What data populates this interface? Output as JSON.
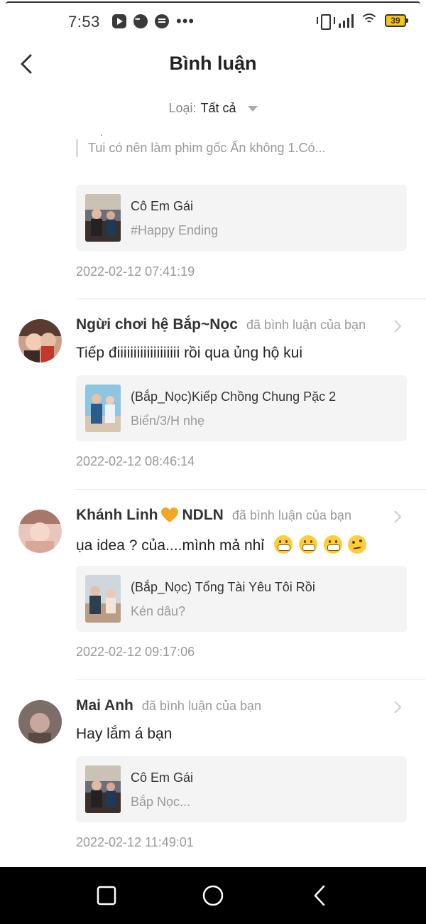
{
  "status_bar": {
    "time": "7:53",
    "battery": "39",
    "app_icons": [
      "youtube-icon",
      "messenger-icon",
      "chat-icon"
    ]
  },
  "header": {
    "title": "Bình luận"
  },
  "filter": {
    "label": "Loại:",
    "value": "Tất cả"
  },
  "partial_item": {
    "quote": "Tui có nên làm phim gốc Ấn không 1.Có...",
    "video_title": "Cô Em Gái",
    "video_subtitle": "#Happy Ending",
    "timestamp": "2022-02-12 07:41:19"
  },
  "comments": [
    {
      "author": "Ngừi chơi hệ Bắp~Nọc",
      "action": "đã bình luận của bạn",
      "text": "Tiếp điiiiiiiiiiiiiiiiiii rồi qua ủng hộ kui",
      "video_title": "(Bắp_Nọc)Kiếp Chồng Chung Pặc 2",
      "video_subtitle": "Biển/3/H nhẹ",
      "timestamp": "2022-02-12 08:46:14"
    },
    {
      "author_a": "Khánh Linh",
      "author_b": "NDLN",
      "action": "đã bình luận của bạn",
      "text": "ụa idea ? của....mình mả nhỉ",
      "emojis": [
        "grimacing-emoji",
        "grimacing-emoji",
        "grimacing-emoji",
        "raised-eyebrow-emoji"
      ],
      "video_title": "(Bắp_Nọc) Tổng Tài Yêu Tôi Rồi",
      "video_subtitle": "Kén dâu?",
      "timestamp": "2022-02-12 09:17:06"
    },
    {
      "author": "Mai Anh",
      "action": "đã bình luận của bạn",
      "text": "Hay lắm á bạn",
      "video_title": "Cô Em Gái",
      "video_subtitle": "Bắp Nọc...",
      "timestamp": "2022-02-12 11:49:01"
    }
  ],
  "nav_bar": [
    "recents-square-icon",
    "home-circle-icon",
    "back-triangle-icon"
  ],
  "colors": {
    "muted_text": "#999999",
    "card_bg": "#f4f4f4",
    "heart": "#f5a623",
    "nav_bar": "#000000"
  }
}
